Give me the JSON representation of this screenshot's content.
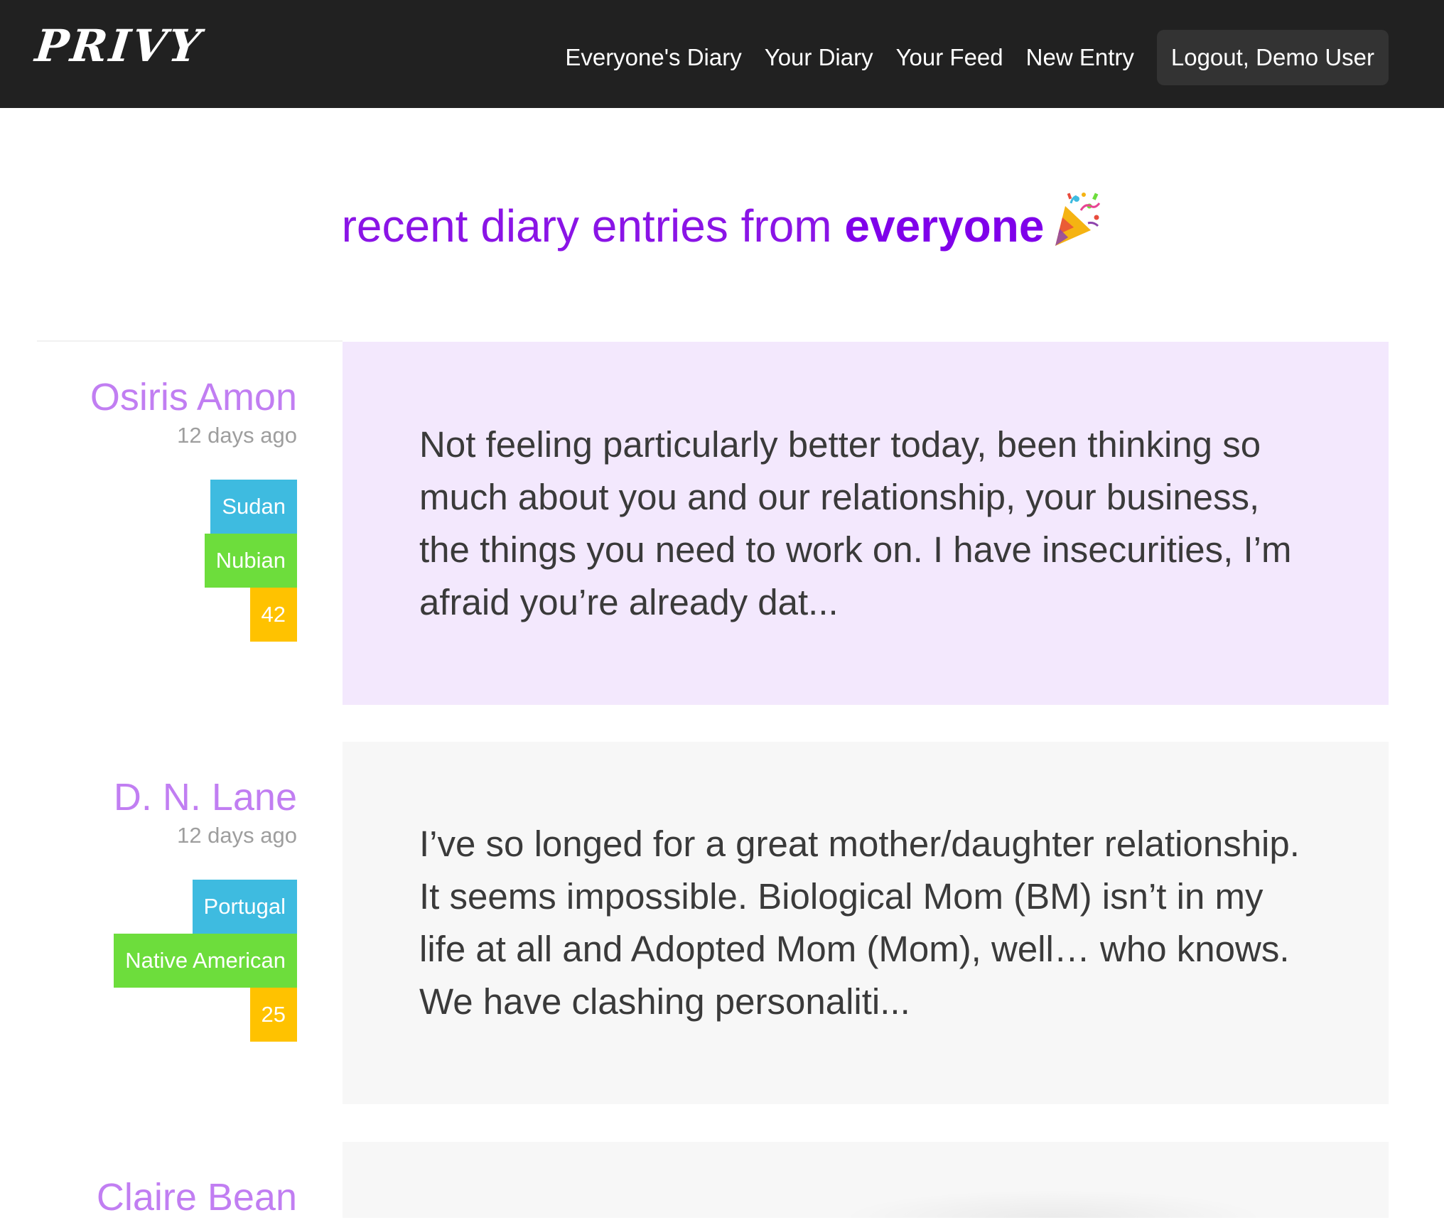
{
  "nav": {
    "brand": "PRIVY",
    "links": [
      "Everyone's Diary",
      "Your Diary",
      "Your Feed",
      "New Entry"
    ],
    "logout": "Logout, Demo User"
  },
  "heading": {
    "prefix": "recent diary entries from ",
    "emphasis": "everyone",
    "icon": "party-popper-icon"
  },
  "colors": {
    "navbar": "#212121",
    "heading": "#8a14e6",
    "author_name": "#c17ef2",
    "tag_country": "#3ebbe0",
    "tag_ethnicity": "#6ddd3c",
    "tag_age": "#ffc200",
    "card_highlight": "#f3e8fd",
    "card_default": "#f7f7f7"
  },
  "entries": [
    {
      "author": "Osiris Amon",
      "time": "12 days ago",
      "tags": {
        "country": "Sudan",
        "ethnicity": "Nubian",
        "age": "42"
      },
      "text": "Not feeling particularly better today, been thinking so much about you and our relationship, your business, the things you need to work on. I have insecurities, I’m afraid you’re already dat...",
      "highlighted": true
    },
    {
      "author": "D. N. Lane",
      "time": "12 days ago",
      "tags": {
        "country": "Portugal",
        "ethnicity": "Native American",
        "age": "25"
      },
      "text": "I’ve so longed for a great mother/daughter relationship. It seems impossible. Biological Mom (BM) isn’t in my life at all and Adopted Mom (Mom), well… who knows. We have clashing personaliti...",
      "highlighted": false
    },
    {
      "author": "Claire Bean",
      "highlighted": false
    }
  ]
}
